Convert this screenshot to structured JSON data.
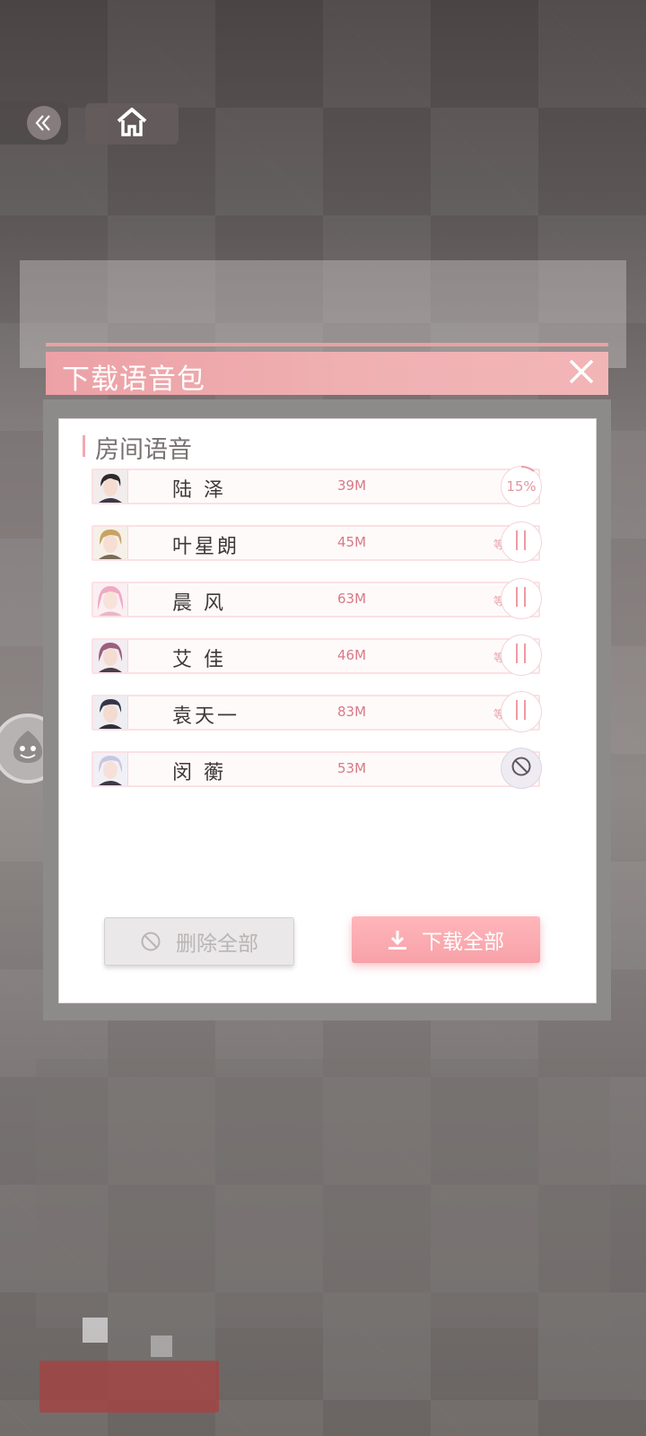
{
  "modal": {
    "title": "下载语音包",
    "section_title": "房间语音",
    "delete_all_label": "删除全部",
    "download_all_label": "下载全部"
  },
  "voice_packs": [
    {
      "name": "陆 泽",
      "size": "39M",
      "status": "",
      "action": "progress",
      "progress_label": "15%",
      "progress_percent": 15
    },
    {
      "name": "叶星朗",
      "size": "45M",
      "status": "等待下载",
      "action": "pause"
    },
    {
      "name": "晨 风",
      "size": "63M",
      "status": "等待下载",
      "action": "pause"
    },
    {
      "name": "艾 佳",
      "size": "46M",
      "status": "等待下载",
      "action": "pause"
    },
    {
      "name": "袁天一",
      "size": "83M",
      "status": "等待下载",
      "action": "pause"
    },
    {
      "name": "闵 蘅",
      "size": "53M",
      "status": "",
      "action": "blocked"
    }
  ],
  "colors": {
    "accent_pink": "#f2a9b0",
    "header_pink": "#eca1a6",
    "size_text": "#d87a86",
    "status_text": "#e7a0a8"
  },
  "icons": {
    "back": "double-chevron-left-icon",
    "home": "home-icon",
    "close": "close-icon",
    "pause": "pause-icon",
    "blocked": "prohibited-icon",
    "download": "download-icon"
  }
}
